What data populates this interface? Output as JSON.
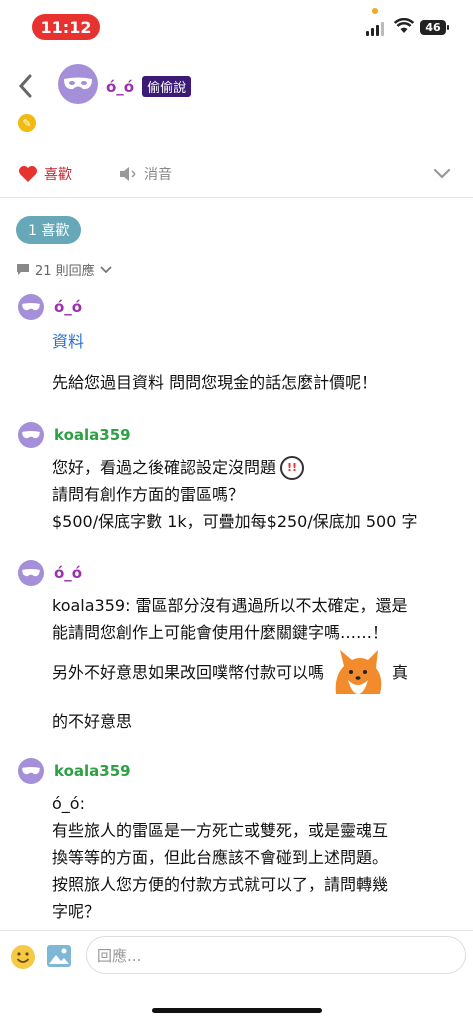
{
  "status_bar": {
    "time": "11:12",
    "battery": "46"
  },
  "header": {
    "username": "ó_ó",
    "tag": "偷偷說"
  },
  "actions": {
    "like_label": "喜歡",
    "mute_label": "消音"
  },
  "likes_pill": "1 喜歡",
  "reply_count": "21 則回應",
  "comments": [
    {
      "author": "ó_ó",
      "lines": [
        "資料",
        "先給您過目資料 問問您現金的話怎麼計價呢！"
      ]
    },
    {
      "author": "koala359",
      "lines": [
        "您好，看過之後確認設定沒問題",
        "請問有創作方面的雷區嗎？",
        "$500/保底字數 1k，可疊加每$250/保底加 500 字"
      ]
    },
    {
      "author": "ó_ó",
      "lines": [
        "koala359: 雷區部分沒有遇過所以不太確定，還是",
        "能請問您創作上可能會使用什麼關鍵字嗎……！",
        "另外不好意思如果改回噗幣付款可以嗎",
        "真",
        "的不好意思"
      ]
    },
    {
      "author": "koala359",
      "lines": [
        "ó_ó:",
        "有些旅人的雷區是一方死亡或雙死，或是靈魂互",
        "換等等的方面，但此台應該不會碰到上述問題。",
        "按照旅人您方便的付款方式就可以了，請問轉幾",
        "字呢？"
      ]
    }
  ],
  "reply_input": {
    "placeholder": "回應..."
  },
  "icons": {
    "back": "chevron-left-icon",
    "heart": "heart-icon",
    "speaker": "speaker-muted-icon",
    "expand": "chevron-down-icon",
    "comment": "comment-bubble-icon",
    "emoji": "smiley-icon",
    "image": "image-icon"
  },
  "colors": {
    "like": "#c0262f",
    "purple_name": "#9b2fae",
    "green_name": "#2ea043",
    "pill": "#66a7b8",
    "link": "#2b6fd6"
  }
}
